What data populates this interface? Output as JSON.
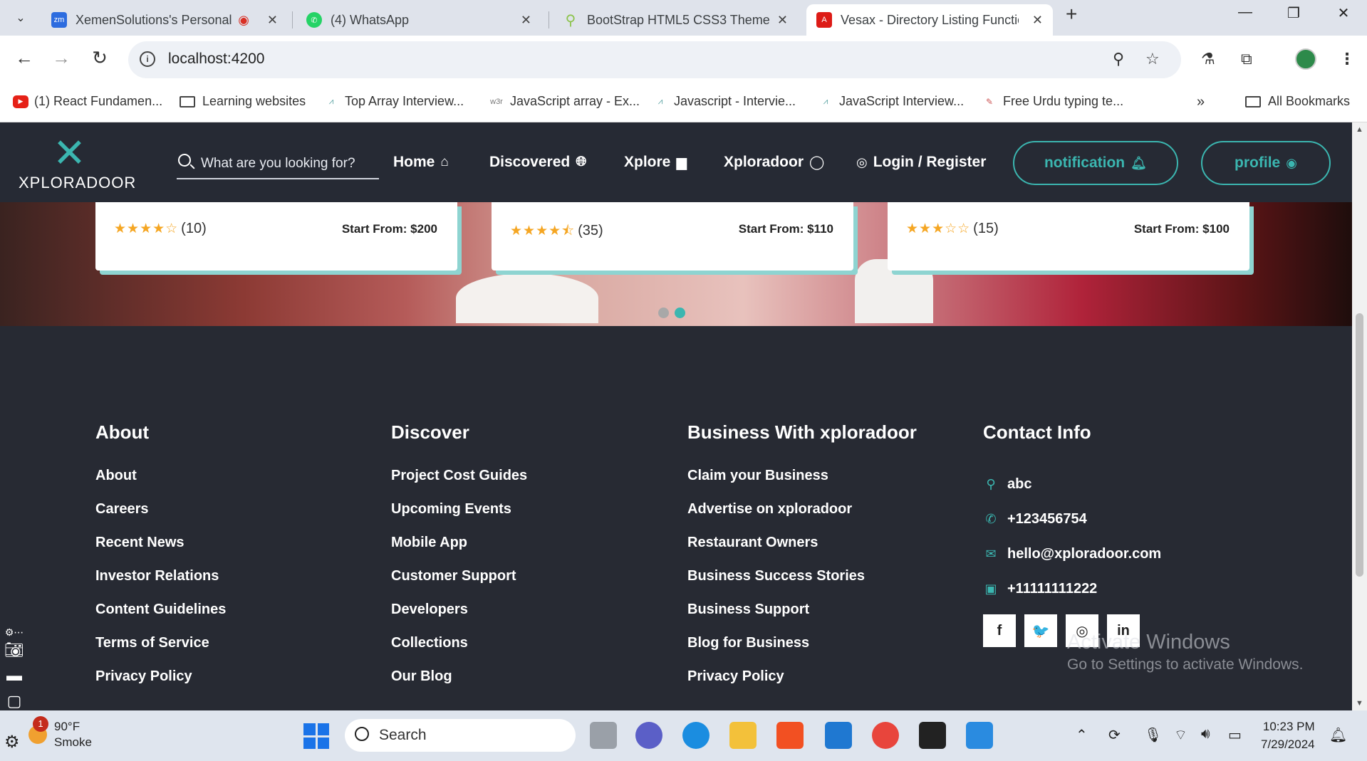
{
  "browser": {
    "tabs": [
      {
        "title": "XemenSolutions's Personal",
        "favicon": "zoom-icon",
        "color": "#2d6cdf"
      },
      {
        "title": "(4) WhatsApp",
        "favicon": "whatsapp-icon",
        "color": "#25d366"
      },
      {
        "title": "BootStrap HTML5 CSS3 Theme",
        "favicon": "location-pin-icon",
        "color": "#8bc34a"
      },
      {
        "title": "Vesax - Directory Listing Functio",
        "favicon": "angular-icon",
        "color": "#dd1b16"
      }
    ],
    "url": "localhost:4200",
    "bookmarks": [
      {
        "label": "(1) React Fundamen...",
        "icon": "youtube-icon"
      },
      {
        "label": "Learning websites",
        "icon": "folder-icon"
      },
      {
        "label": "Top Array Interview...",
        "icon": "site-icon"
      },
      {
        "label": "JavaScript array - Ex...",
        "icon": "w3r-icon",
        "prefix": "w3r"
      },
      {
        "label": "Javascript - Intervie...",
        "icon": "site-icon"
      },
      {
        "label": "JavaScript Interview...",
        "icon": "site-icon"
      },
      {
        "label": "Free Urdu typing te...",
        "icon": "site-icon"
      }
    ],
    "all_bookmarks": "All Bookmarks"
  },
  "header": {
    "logo_text": "XPLORADOOR",
    "search_placeholder": "What are you looking for?",
    "nav": [
      {
        "label": "Home",
        "icon": "home-icon"
      },
      {
        "label": "Discovered",
        "icon": "globe-icon"
      },
      {
        "label": "Xplore",
        "icon": "briefcase-icon"
      },
      {
        "label": "Xploradoor",
        "icon": "circle-icon"
      },
      {
        "label": "Login / Register",
        "icon": "user-icon"
      }
    ],
    "notification_label": "notification",
    "profile_label": "profile",
    "accent": "#3bb6b0"
  },
  "cards": [
    {
      "rating": 4,
      "count": "(10)",
      "price": "Start From: $200"
    },
    {
      "rating": 4.5,
      "count": "(35)",
      "price": "Start From: $110"
    },
    {
      "rating": 3,
      "count": "(15)",
      "price": "Start From: $100"
    }
  ],
  "footer": {
    "columns": [
      {
        "title": "About",
        "links": [
          "About",
          "Careers",
          "Recent News",
          "Investor Relations",
          "Content Guidelines",
          "Terms of Service",
          "Privacy Policy"
        ]
      },
      {
        "title": "Discover",
        "links": [
          "Project Cost Guides",
          "Upcoming Events",
          "Mobile App",
          "Customer Support",
          "Developers",
          "Collections",
          "Our Blog"
        ]
      },
      {
        "title": "Business With xploradoor",
        "links": [
          "Claim your Business",
          "Advertise on xploradoor",
          "Restaurant Owners",
          "Business Success Stories",
          "Business Support",
          "Blog for Business",
          "Privacy Policy"
        ]
      }
    ],
    "contact": {
      "title": "Contact Info",
      "items": [
        {
          "icon": "location-icon",
          "text": "abc"
        },
        {
          "icon": "phone-icon",
          "text": "+123456754"
        },
        {
          "icon": "mail-icon",
          "text": "hello@xploradoor.com"
        },
        {
          "icon": "fax-icon",
          "text": "+11111111222"
        }
      ]
    },
    "socials": [
      {
        "icon": "facebook-icon",
        "glyph": "f"
      },
      {
        "icon": "twitter-icon",
        "glyph": "🐦"
      },
      {
        "icon": "instagram-icon",
        "glyph": "◎"
      },
      {
        "icon": "linkedin-icon",
        "glyph": "in"
      }
    ]
  },
  "watermark": {
    "line1": "Activate Windows",
    "line2": "Go to Settings to activate Windows."
  },
  "taskbar": {
    "weather_temp": "90°F",
    "weather_desc": "Smoke",
    "badge": "1",
    "search_label": "Search",
    "time": "10:23 PM",
    "date": "7/29/2024"
  }
}
